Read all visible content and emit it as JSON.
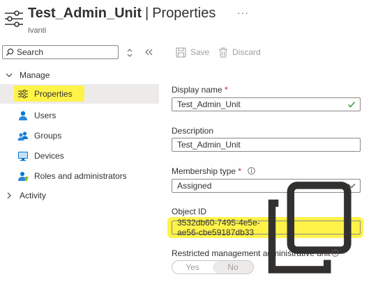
{
  "header": {
    "title": "Test_Admin_Unit",
    "separator": "|",
    "page": "Properties",
    "more": "···",
    "subtitle": "Ivanti"
  },
  "nav": {
    "search": {
      "placeholder": "Search"
    },
    "groups": [
      {
        "label": "Manage",
        "expanded": true
      },
      {
        "label": "Activity",
        "expanded": false
      }
    ],
    "items": [
      {
        "label": "Properties",
        "icon": "properties-icon",
        "selected": true
      },
      {
        "label": "Users",
        "icon": "user-icon",
        "selected": false
      },
      {
        "label": "Groups",
        "icon": "groups-icon",
        "selected": false
      },
      {
        "label": "Devices",
        "icon": "devices-icon",
        "selected": false
      },
      {
        "label": "Roles and administrators",
        "icon": "roles-icon",
        "selected": false
      }
    ]
  },
  "toolbar": {
    "save_label": "Save",
    "discard_label": "Discard"
  },
  "form": {
    "display_name": {
      "label": "Display name",
      "required": "*",
      "value": "Test_Admin_Unit"
    },
    "description": {
      "label": "Description",
      "value": "Test_Admin_Unit"
    },
    "membership_type": {
      "label": "Membership type",
      "required": "*",
      "value": "Assigned"
    },
    "object_id": {
      "label": "Object ID",
      "value": "3532db60-7495-4e5e-ae56-cbe59187db33"
    },
    "restricted": {
      "label": "Restricted management administrative unit",
      "yes": "Yes",
      "no": "No",
      "selected": "No"
    }
  },
  "colors": {
    "highlight": "#fff34a",
    "accent": "#0078d4",
    "valid": "#107c10",
    "required": "#a4262c"
  }
}
